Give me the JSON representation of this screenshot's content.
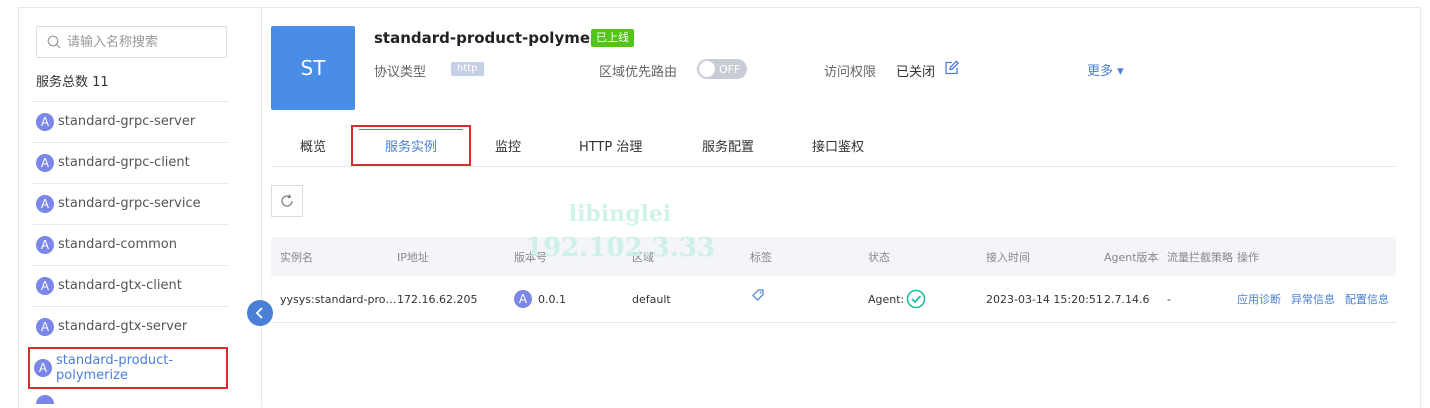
{
  "sidebar": {
    "search_placeholder": "请输入名称搜索",
    "total_label": "服务总数 11",
    "items": [
      {
        "badge": "A",
        "label": "standard-grpc-server"
      },
      {
        "badge": "A",
        "label": "standard-grpc-client"
      },
      {
        "badge": "A",
        "label": "standard-grpc-service"
      },
      {
        "badge": "A",
        "label": "standard-common"
      },
      {
        "badge": "A",
        "label": "standard-gtx-client"
      },
      {
        "badge": "A",
        "label": "standard-gtx-server"
      },
      {
        "badge": "A",
        "label": "standard-product-polymerize"
      }
    ]
  },
  "header": {
    "avatar_text": "ST",
    "title": "standard-product-polymerize",
    "status_badge": "已上线",
    "protocol_label": "协议类型",
    "protocol_value": "http",
    "region_route_label": "区域优先路由",
    "region_route_toggle": "OFF",
    "access_label": "访问权限",
    "access_value": "已关闭",
    "more_label": "更多 ▾"
  },
  "tabs": [
    "概览",
    "服务实例",
    "监控",
    "HTTP 治理",
    "服务配置",
    "接口鉴权"
  ],
  "watermark": {
    "line1": "libinglei",
    "line2": "192.102.3.33"
  },
  "table": {
    "headers": [
      "实例名",
      "IP地址",
      "版本号",
      "区域",
      "标签",
      "状态",
      "接入时间",
      "Agent版本",
      "流量拦截策略",
      "操作"
    ],
    "rows": [
      {
        "name": "yysys:standard-pro…",
        "ip": "172.16.62.205",
        "version_badge": "A",
        "version": "0.0.1",
        "region": "default",
        "status": "Agent:",
        "joined": "2023-03-14 15:20:51",
        "agent_version": "2.7.14.6",
        "traffic": "-",
        "actions": [
          "应用诊断",
          "异常信息",
          "配置信息"
        ]
      }
    ]
  },
  "colors": {
    "accent": "#4a7fd6",
    "online": "#52c41a",
    "highlight_border": "#d32f2f",
    "check": "#1fbf9f"
  }
}
